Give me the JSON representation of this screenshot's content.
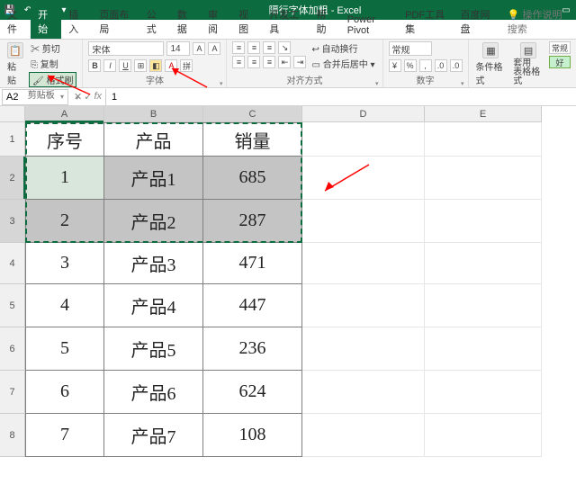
{
  "titlebar": {
    "doc_title": "隔行字体加粗 - Excel"
  },
  "menutabs": {
    "file": "文件",
    "home": "开始",
    "insert": "插入",
    "layout": "页面布局",
    "formulas": "公式",
    "data": "数据",
    "review": "审阅",
    "view": "视图",
    "dev": "开发工具",
    "help": "帮助",
    "powerpivot": "Power Pivot",
    "pdf": "PDF工具集",
    "baidu": "百度网盘",
    "tellme": "操作说明搜索"
  },
  "ribbon": {
    "clipboard": {
      "paste": "粘贴",
      "cut": "剪切",
      "copy": "复制",
      "format_painter": "格式刷",
      "label": "剪贴板"
    },
    "font": {
      "name": "宋体",
      "size": "14",
      "label": "字体",
      "bold": "B",
      "italic": "I",
      "underline": "U"
    },
    "align": {
      "wrap": "自动换行",
      "merge": "合并后居中",
      "label": "对齐方式"
    },
    "number": {
      "label": "数字",
      "format": "常规"
    },
    "styles": {
      "cond": "条件格式",
      "table": "套用\n表格格式",
      "normal": "常规",
      "good": "好"
    }
  },
  "namebox": {
    "ref": "A2"
  },
  "formula": {
    "value": "1"
  },
  "columns": [
    "A",
    "B",
    "C",
    "D",
    "E"
  ],
  "chart_data": {
    "type": "table",
    "headers": [
      "序号",
      "产品",
      "销量"
    ],
    "rows": [
      {
        "序号": "1",
        "产品": "产品1",
        "销量": "685"
      },
      {
        "序号": "2",
        "产品": "产品2",
        "销量": "287"
      },
      {
        "序号": "3",
        "产品": "产品3",
        "销量": "471"
      },
      {
        "序号": "4",
        "产品": "产品4",
        "销量": "447"
      },
      {
        "序号": "5",
        "产品": "产品5",
        "销量": "236"
      },
      {
        "序号": "6",
        "产品": "产品6",
        "销量": "624"
      },
      {
        "序号": "7",
        "产品": "产品7",
        "销量": "108"
      }
    ]
  }
}
